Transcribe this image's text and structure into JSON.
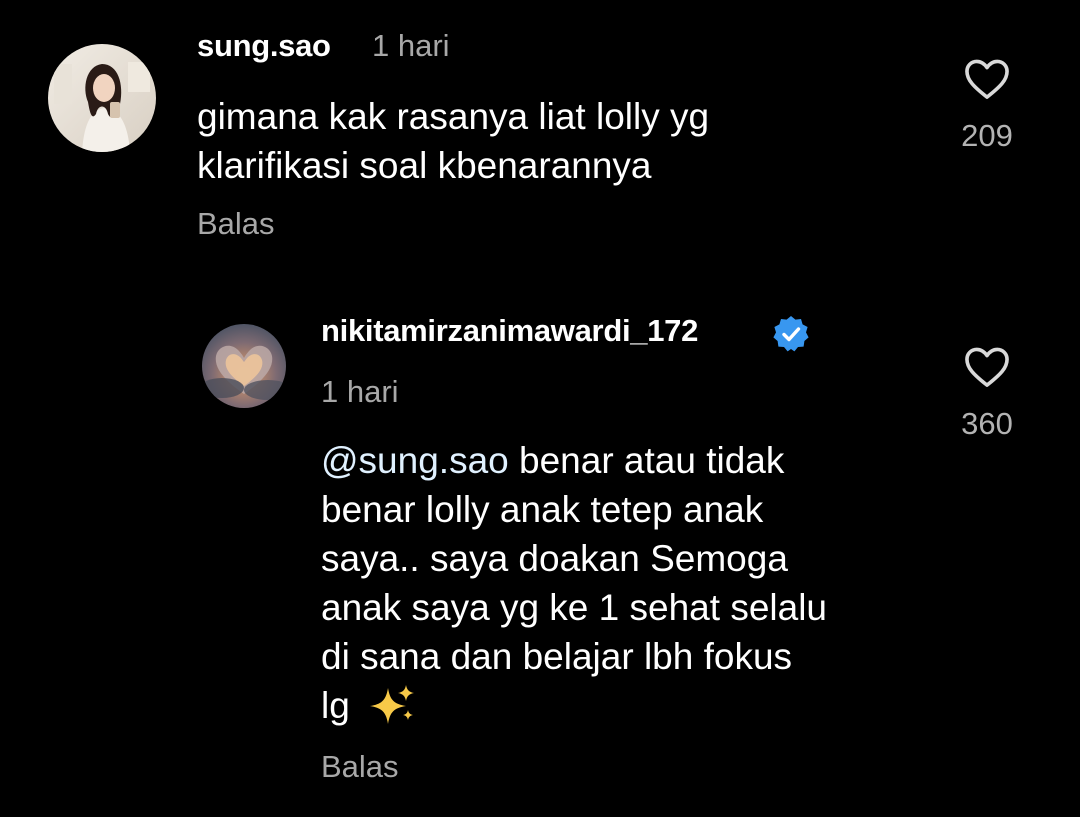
{
  "comments": [
    {
      "username": "sung.sao",
      "time": "1 hari",
      "body_lines": [
        "gimana kak rasanya liat lolly yg",
        "klarifikasi soal kbenarannya"
      ],
      "reply_label": "Balas",
      "likes": "209",
      "avatar_icon": "profile-photo-woman"
    }
  ],
  "reply": {
    "username": "nikitamirzanimawardi_172",
    "verified": true,
    "verified_icon": "verified-badge-icon",
    "time": "1 hari",
    "mention": "@sung.sao",
    "first_line_rest": " benar atau tidak",
    "body_lines": [
      "benar lolly anak tetep anak",
      "saya.. saya doakan Semoga",
      "anak saya yg ke 1 sehat selalu",
      "di sana dan belajar lbh fokus"
    ],
    "last_line": "lg",
    "last_line_emoji": "sparkles-emoji",
    "reply_label": "Balas",
    "likes": "360",
    "avatar_icon": "profile-photo-heart-cloud"
  },
  "colors": {
    "background": "#000000",
    "primary_text": "#ffffff",
    "secondary_text": "#a8a8a8",
    "verified": "#3897f0",
    "sparkle": "#f7c948"
  },
  "icons": {
    "like": "heart-outline-icon"
  }
}
